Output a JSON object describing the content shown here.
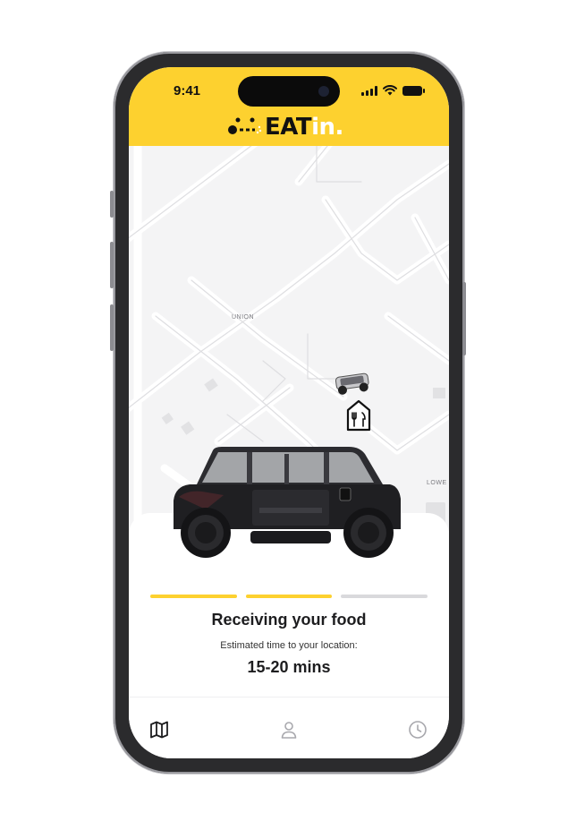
{
  "status_bar": {
    "time": "9:41",
    "icons": [
      "signal-icon",
      "wifi-icon",
      "battery-icon"
    ]
  },
  "brand": {
    "logo_main": "EAT",
    "logo_accent": "in.",
    "header_color": "#fdd12f"
  },
  "map": {
    "labels": {
      "area_1": "UNION",
      "area_2": "LOWE"
    },
    "markers": [
      "delivery-vehicle-icon",
      "restaurant-pin-icon"
    ]
  },
  "order_status": {
    "title": "Receiving your food",
    "subtitle": "Estimated time to your location:",
    "eta": "15-20 mins",
    "progress": {
      "steps_total": 3,
      "steps_done": 2,
      "active_color": "#fdd12f",
      "inactive_color": "#d9d9dc"
    }
  },
  "tabbar": {
    "items": [
      {
        "icon": "map-icon",
        "active": true
      },
      {
        "icon": "user-icon",
        "active": false
      },
      {
        "icon": "clock-icon",
        "active": false
      }
    ]
  }
}
